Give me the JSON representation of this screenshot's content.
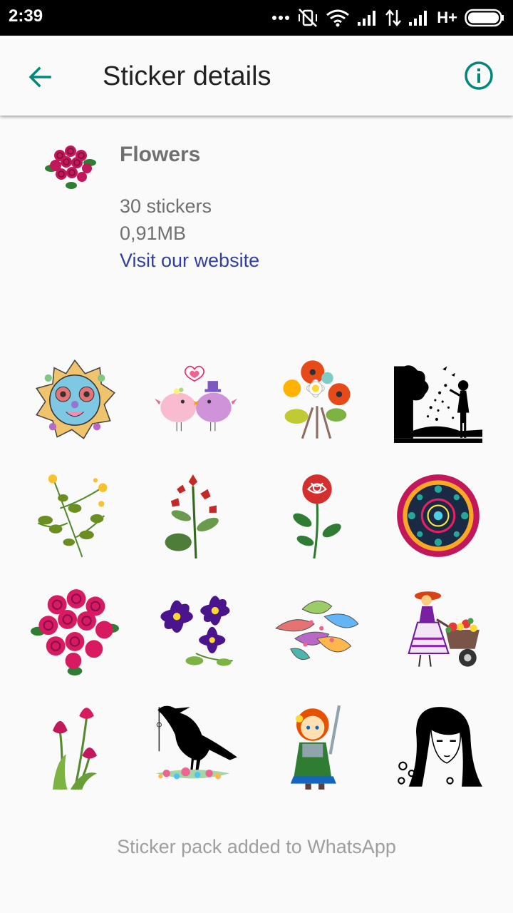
{
  "status_bar": {
    "time": "2:39",
    "network_type": "H+",
    "icons": [
      "more-dots-icon",
      "vibrate-off-icon",
      "wifi-icon",
      "signal-icon",
      "data-arrows-icon",
      "signal-icon",
      "battery-icon"
    ]
  },
  "app_bar": {
    "title": "Sticker details",
    "back_icon": "arrow-back-icon",
    "info_icon": "info-icon",
    "accent_color": "#00897b"
  },
  "pack": {
    "name": "Flowers",
    "count": "30 stickers",
    "size": "0,91MB",
    "website_link": "Visit our website",
    "link_color": "#303f9f"
  },
  "stickers": [
    {
      "name": "mandala-lion-sticker"
    },
    {
      "name": "love-birds-sticker"
    },
    {
      "name": "poppy-daisy-bouquet-sticker"
    },
    {
      "name": "boy-silhouette-tree-sticker"
    },
    {
      "name": "yellow-wildflower-sticker"
    },
    {
      "name": "red-bells-flower-sticker"
    },
    {
      "name": "red-rose-sticker"
    },
    {
      "name": "round-mandala-sticker"
    },
    {
      "name": "roses-bouquet-sticker"
    },
    {
      "name": "purple-clematis-sticker"
    },
    {
      "name": "paisley-feathers-sticker"
    },
    {
      "name": "girl-wheelbarrow-sticker"
    },
    {
      "name": "pink-tulips-sticker"
    },
    {
      "name": "raven-flowers-sticker"
    },
    {
      "name": "warrior-girl-sticker"
    },
    {
      "name": "girl-portrait-sticker"
    }
  ],
  "footer": {
    "status_text": "Sticker pack added to WhatsApp"
  }
}
